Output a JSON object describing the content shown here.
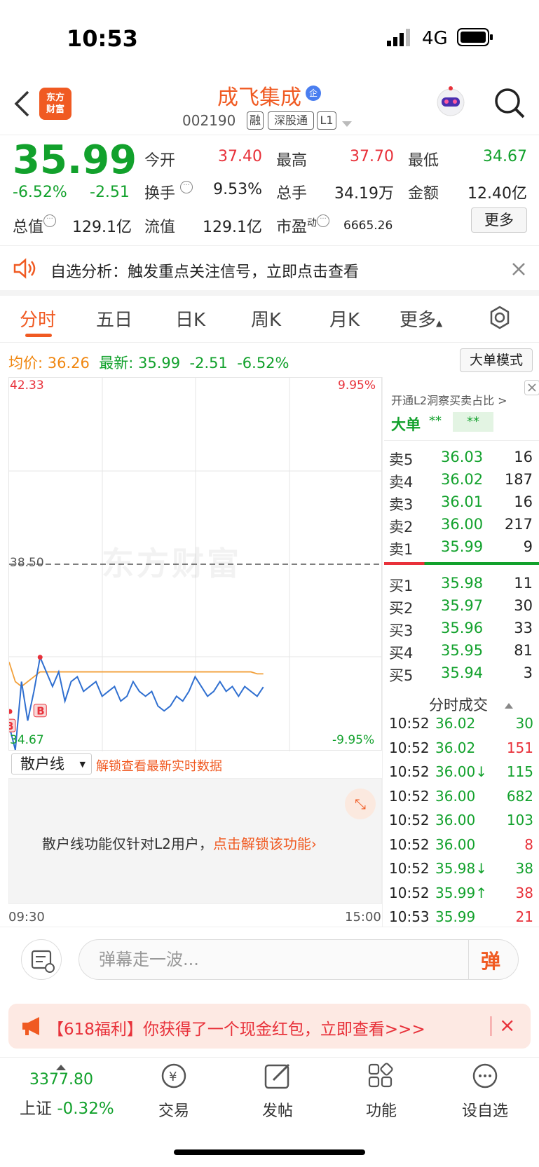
{
  "status_bar": {
    "time": "10:53",
    "network": "4G"
  },
  "header": {
    "logo_line1": "东方",
    "logo_line2": "财富",
    "stock_name": "成飞集成",
    "qi_badge": "企",
    "stock_code": "002190",
    "tags": [
      "融",
      "深股通",
      "L1"
    ]
  },
  "quote": {
    "price": "35.99",
    "change_pct": "-6.52%",
    "change": "-2.51",
    "open_label": "今开",
    "open": "37.40",
    "high_label": "最高",
    "high": "37.70",
    "low_label": "最低",
    "low": "34.67",
    "turnover_label": "换手",
    "turnover": "9.53%",
    "volume_label": "总手",
    "volume": "34.19万",
    "amount_label": "金额",
    "amount": "12.40亿",
    "mktcap_label": "总值",
    "mktcap": "129.1亿",
    "float_label": "流值",
    "float": "129.1亿",
    "pe_label": "市盈",
    "pe_sup": "动",
    "pe": "6665.26",
    "more_label": "更多"
  },
  "notice": {
    "text": "自选分析：触发重点关注信号，立即点击查看"
  },
  "tabs": [
    "分时",
    "五日",
    "日K",
    "周K",
    "月K",
    "更多"
  ],
  "info_line": {
    "avg_label": "均价:",
    "avg": "36.26",
    "latest_label": "最新:",
    "latest": "35.99",
    "latest_chg": "-2.51",
    "latest_pct": "-6.52%",
    "mode_btn": "大单模式"
  },
  "chart_data": {
    "type": "line",
    "ylim": [
      34.67,
      42.33
    ],
    "y_top_label": "42.33",
    "y_mid_label": "38.50",
    "y_bottom_label": "34.67",
    "pct_top_label": "9.95%",
    "pct_bottom_label": "-9.95%",
    "watermark": "东方财富",
    "x_start": "09:30",
    "x_end": "15:00",
    "series": [
      {
        "name": "price",
        "color": "#2f6fd0",
        "values": [
          35.2,
          34.7,
          36.1,
          35.3,
          35.9,
          36.6,
          36.3,
          36.0,
          36.3,
          35.7,
          36.1,
          36.2,
          35.9,
          36.0,
          36.1,
          35.8,
          35.9,
          36.0,
          35.7,
          35.8,
          36.1,
          35.9,
          35.8,
          35.9,
          35.6,
          35.5,
          35.6,
          35.8,
          35.7,
          35.9,
          36.2,
          36.0,
          35.8,
          35.9,
          36.1,
          35.9,
          36.0,
          35.8,
          36.0,
          35.9,
          35.8,
          35.99
        ]
      },
      {
        "name": "avg",
        "color": "#f2a03a",
        "values": [
          36.5,
          36.1,
          36.0,
          36.1,
          36.2,
          36.3,
          36.3,
          36.3,
          36.3,
          36.3,
          36.3,
          36.3,
          36.3,
          36.3,
          36.3,
          36.3,
          36.3,
          36.3,
          36.3,
          36.3,
          36.3,
          36.3,
          36.3,
          36.3,
          36.3,
          36.3,
          36.3,
          36.3,
          36.3,
          36.3,
          36.3,
          36.3,
          36.3,
          36.3,
          36.3,
          36.3,
          36.3,
          36.3,
          36.3,
          36.3,
          36.26,
          36.26
        ]
      }
    ],
    "total_points": 242
  },
  "order_book": {
    "header": "开通L2洞察买卖占比 >",
    "dadan_label": "大单",
    "dadan_val1": "**",
    "dadan_val2": "**",
    "sell": [
      {
        "label": "卖5",
        "price": "36.03",
        "vol": "16"
      },
      {
        "label": "卖4",
        "price": "36.02",
        "vol": "187"
      },
      {
        "label": "卖3",
        "price": "36.01",
        "vol": "16"
      },
      {
        "label": "卖2",
        "price": "36.00",
        "vol": "217"
      },
      {
        "label": "卖1",
        "price": "35.99",
        "vol": "9"
      }
    ],
    "buy": [
      {
        "label": "买1",
        "price": "35.98",
        "vol": "11"
      },
      {
        "label": "买2",
        "price": "35.97",
        "vol": "30"
      },
      {
        "label": "买3",
        "price": "35.96",
        "vol": "33"
      },
      {
        "label": "买4",
        "price": "35.95",
        "vol": "81"
      },
      {
        "label": "买5",
        "price": "35.94",
        "vol": "3"
      }
    ],
    "ticks_title": "分时成交",
    "ticks": [
      {
        "time": "10:52",
        "price": "36.02",
        "vol": "30",
        "dir": ""
      },
      {
        "time": "10:52",
        "price": "36.02",
        "vol": "151",
        "dir": ""
      },
      {
        "time": "10:52",
        "price": "36.00↓",
        "vol": "115",
        "dir": ""
      },
      {
        "time": "10:52",
        "price": "36.00",
        "vol": "682",
        "dir": ""
      },
      {
        "time": "10:52",
        "price": "36.00",
        "vol": "103",
        "dir": ""
      },
      {
        "time": "10:52",
        "price": "36.00",
        "vol": "8",
        "dir": ""
      },
      {
        "time": "10:52",
        "price": "35.98↓",
        "vol": "38",
        "dir": ""
      },
      {
        "time": "10:52",
        "price": "35.99↑",
        "vol": "38",
        "dir": ""
      },
      {
        "time": "10:53",
        "price": "35.99",
        "vol": "21",
        "dir": ""
      }
    ]
  },
  "retail": {
    "select": "散户线",
    "hint": "解锁查看最新实时数据",
    "msg_prefix": "散户线功能仅针对L2用户，",
    "msg_link": "点击解锁该功能"
  },
  "danmu": {
    "placeholder": "弹幕走一波...",
    "send": "弹"
  },
  "promo": {
    "text": "【618福利】你获得了一个现金红包，立即查看>>>"
  },
  "bottom_nav": {
    "index_value": "3377.80",
    "index_name": "上证",
    "index_pct": "-0.32%",
    "items": [
      "交易",
      "发帖",
      "功能",
      "设自选"
    ]
  },
  "colors": {
    "up": "#e8313a",
    "down": "#12a12c",
    "brand": "#f05a22"
  }
}
